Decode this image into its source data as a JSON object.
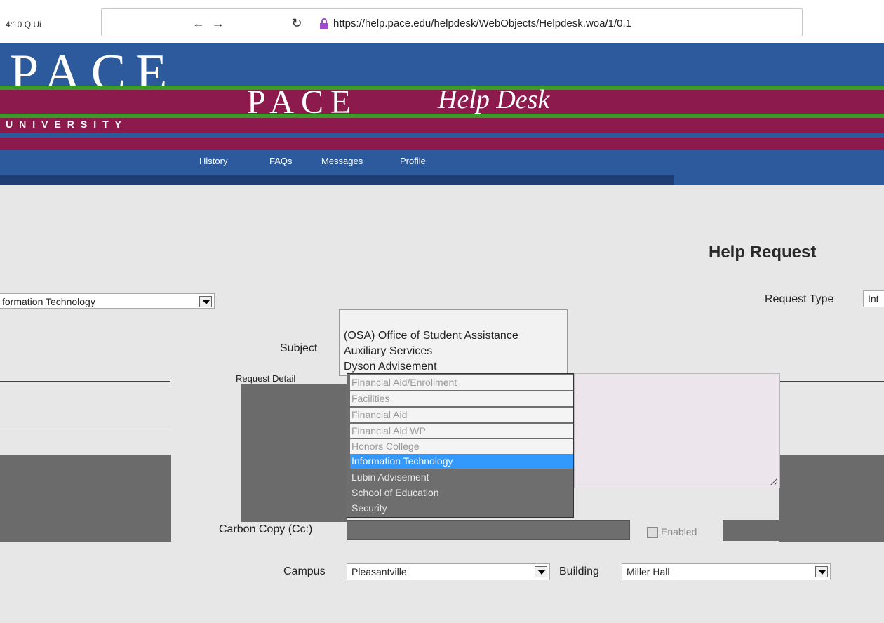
{
  "browser": {
    "tab_text": "4:10 Q  Ui",
    "url": "https://help.pace.edu/helpdesk/WebObjects/Helpdesk.woa/1/0.1"
  },
  "header": {
    "logo_text": "PACE",
    "logo_small": "PACE",
    "title": "Help Desk",
    "university": "UNIVERSITY",
    "nav": [
      "History",
      "FAQs",
      "Messages",
      "Profile"
    ]
  },
  "page": {
    "title": "Help Request"
  },
  "form": {
    "left_select_value": "formation Technology",
    "request_type_label": "Request Type",
    "request_type_value": "Int",
    "subject_label": "Subject",
    "request_detail_label": "Request Detail",
    "cc_label": "Carbon Copy (Cc:)",
    "enabled_label": "Enabled",
    "campus_label": "Campus",
    "campus_value": "Pleasantville",
    "building_label": "Building",
    "building_value": "Miller Hall"
  },
  "dropdown_top": [
    "(OSA) Office of Student Assistance",
    "Auxiliary Services",
    "Dyson Advisement"
  ],
  "dropdown_list": [
    {
      "label": "Financial Aid/Enrollment",
      "state": "light"
    },
    {
      "label": "Facilities",
      "state": "light"
    },
    {
      "label": "Financial Aid",
      "state": "light"
    },
    {
      "label": "Financial Aid WP",
      "state": "light"
    },
    {
      "label": "Honors College",
      "state": "light"
    },
    {
      "label": "Information Technology",
      "state": "selected"
    },
    {
      "label": "Lubin Advisement",
      "state": "normal"
    },
    {
      "label": "School of Education",
      "state": "normal"
    },
    {
      "label": "Security",
      "state": "normal"
    }
  ],
  "colors": {
    "header_blue": "#2c5a9c",
    "maroon": "#8c1a4c",
    "green": "#3a9b2b",
    "selected": "#3399ff"
  }
}
